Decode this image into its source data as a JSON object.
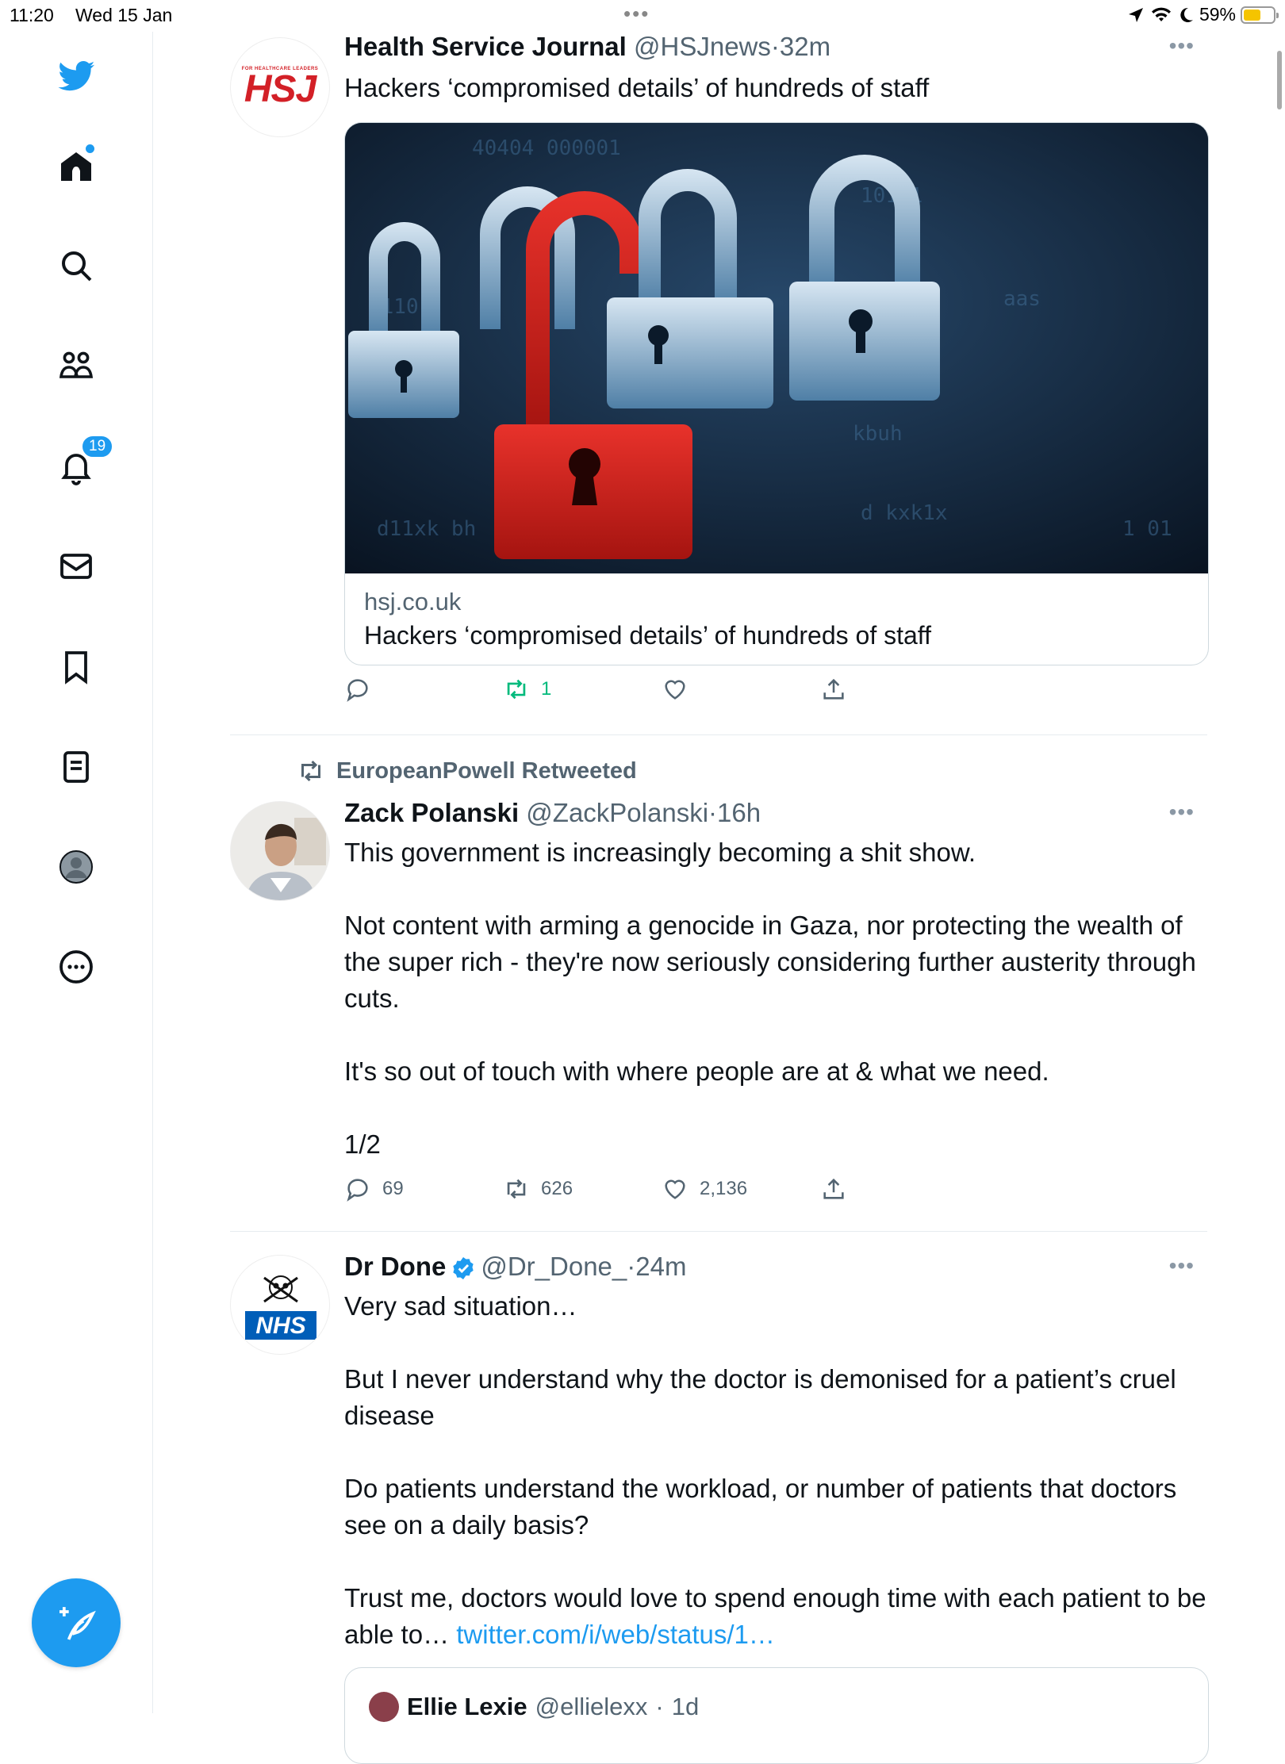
{
  "status_bar": {
    "time": "11:20",
    "date": "Wed 15 Jan",
    "battery": "59%",
    "battery_level": 0.59
  },
  "sidebar": {
    "notifications_badge": "19"
  },
  "tweets": [
    {
      "name": "Health Service Journal",
      "handle": "@HSJnews",
      "time": "32m",
      "text": "Hackers ‘compromised details’ of hundreds of staff",
      "avatar_text": "HSJ",
      "avatar_subtext": "FOR HEALTHCARE LEADERS",
      "card": {
        "domain": "hsj.co.uk",
        "title": "Hackers ‘compromised details’ of hundreds of staff"
      },
      "stats": {
        "replies": "",
        "retweets": "1",
        "likes": ""
      }
    },
    {
      "retweeted_by": "EuropeanPowell Retweeted",
      "name": "Zack Polanski",
      "handle": "@ZackPolanski",
      "time": "16h",
      "paragraphs": [
        "This government is increasingly becoming a shit show.",
        "Not content with arming a genocide in Gaza, nor protecting the wealth of the super rich - they're now seriously considering further austerity through cuts.",
        "It's so out of touch with where people are at & what we need.",
        "1/2"
      ],
      "stats": {
        "replies": "69",
        "retweets": "626",
        "likes": "2,136"
      }
    },
    {
      "name": "Dr Done",
      "handle": "@Dr_Done_",
      "time": "24m",
      "avatar_text": "NHS",
      "paragraphs": [
        "Very sad situation…",
        "But I never understand why the doctor is demonised for a patient’s cruel disease",
        "Do patients understand the workload, or number of patients that doctors see on a daily basis?",
        "Trust me, doctors would love to spend enough time with each patient to be able to…"
      ],
      "link": "twitter.com/i/web/status/1…",
      "quoted": {
        "name": "Ellie Lexie",
        "handle": "@ellielexx",
        "time": "1d"
      }
    }
  ],
  "colors": {
    "accent": "#1d9bf0",
    "retweet_green": "#00ba7c",
    "hsj_red": "#d32027",
    "nhs_blue": "#005eb8"
  }
}
